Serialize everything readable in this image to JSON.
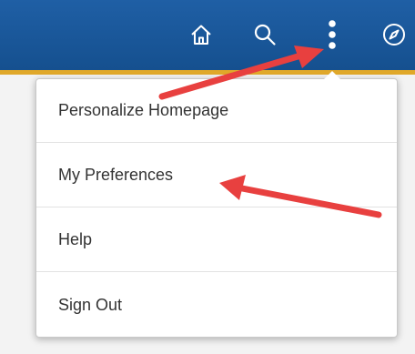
{
  "header": {
    "icons": {
      "home": "home-icon",
      "search": "search-icon",
      "actions": "vertical-ellipsis-icon",
      "navbar": "compass-icon"
    },
    "background_color": "#15508f",
    "stripe_color": "#e0a82a"
  },
  "actions_menu": {
    "items": [
      {
        "label": "Personalize Homepage"
      },
      {
        "label": "My Preferences"
      },
      {
        "label": "Help"
      },
      {
        "label": "Sign Out"
      }
    ]
  },
  "annotations": {
    "arrow_color": "#e8403f"
  }
}
